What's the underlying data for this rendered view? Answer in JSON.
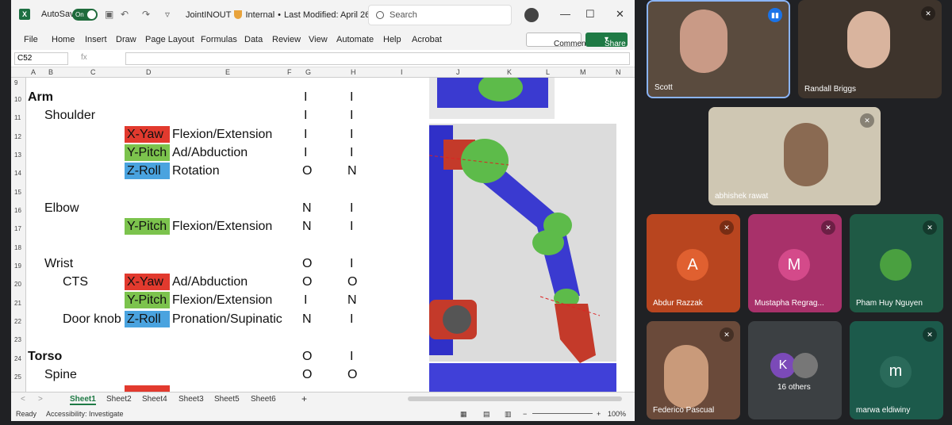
{
  "excel": {
    "autosave_label": "AutoSave",
    "autosave_state": "On",
    "doc_title": "JointINOUT",
    "sensitivity": "Internal",
    "modified": "Last Modified: April 26",
    "search_placeholder": "Search",
    "menu": [
      "File",
      "Home",
      "Insert",
      "Draw",
      "Page Layout",
      "Formulas",
      "Data",
      "Review",
      "View",
      "Automate",
      "Help",
      "Acrobat"
    ],
    "comments_label": "Comments",
    "share_label": "Share",
    "namebox": "C52",
    "fx": "fx",
    "columns": [
      "A",
      "B",
      "C",
      "D",
      "E",
      "F",
      "G",
      "H",
      "I",
      "J",
      "K",
      "L",
      "M",
      "N"
    ],
    "rows": [
      "9",
      "10",
      "11",
      "12",
      "13",
      "14",
      "15",
      "16",
      "17",
      "18",
      "19",
      "20",
      "21",
      "22",
      "23",
      "24",
      "25"
    ],
    "cells": {
      "arm": "Arm",
      "shoulder": "Shoulder",
      "xyaw1": "X-Yaw",
      "flex1": "Flexion/Extension",
      "ypitch1": "Y-Pitch",
      "adab1": "Ad/Abduction",
      "zroll1": "Z-Roll",
      "rot": "Rotation",
      "elbow": "Elbow",
      "ypitch2": "Y-Pitch",
      "flex2": "Flexion/Extension",
      "wrist": "Wrist",
      "cts": "CTS",
      "xyaw2": "X-Yaw",
      "adab2": "Ad/Abduction",
      "ypitch3": "Y-Pitch",
      "flex3": "Flexion/Extension",
      "doorknob": "Door knob",
      "zroll2": "Z-Roll",
      "pron": "Pronation/Supinatic",
      "torso": "Torso",
      "spine": "Spine"
    },
    "g_col": [
      "I",
      "I",
      "I",
      "I",
      "O",
      "N",
      "N",
      "O",
      "O",
      "I",
      "N",
      "O",
      "O"
    ],
    "h_col": [
      "I",
      "I",
      "I",
      "I",
      "N",
      "I",
      "I",
      "I",
      "O",
      "N",
      "I",
      "I",
      "O"
    ],
    "sheets": [
      "Sheet1",
      "Sheet2",
      "Sheet4",
      "Sheet3",
      "Sheet5",
      "Sheet6"
    ],
    "add_sheet": "+",
    "status_ready": "Ready",
    "accessibility": "Accessibility: Investigate",
    "zoom": "100%",
    "colors": {
      "red": "#e23a2e",
      "green": "#7cc34d",
      "blue": "#4aa3df",
      "excel_green": "#1f7a45"
    }
  },
  "meet": {
    "participants": [
      {
        "name": "Scott",
        "muted": false,
        "speaking": true
      },
      {
        "name": "Randall Briggs",
        "muted": true
      },
      {
        "name": "abhishek rawat",
        "muted": true
      },
      {
        "name": "Abdur Razzak",
        "initial": "A",
        "muted": true,
        "color": "#b8451f"
      },
      {
        "name": "Mustapha Regrag...",
        "initial": "M",
        "muted": true,
        "color": "#a8316a"
      },
      {
        "name": "Pham Huy Nguyen",
        "muted": true
      },
      {
        "name": "Federico Pascual",
        "muted": true
      },
      {
        "name": "16 others",
        "initial": "K"
      },
      {
        "name": "marwa eldiwiny",
        "initial": "m",
        "muted": true,
        "color": "#1c5a4b"
      }
    ]
  }
}
